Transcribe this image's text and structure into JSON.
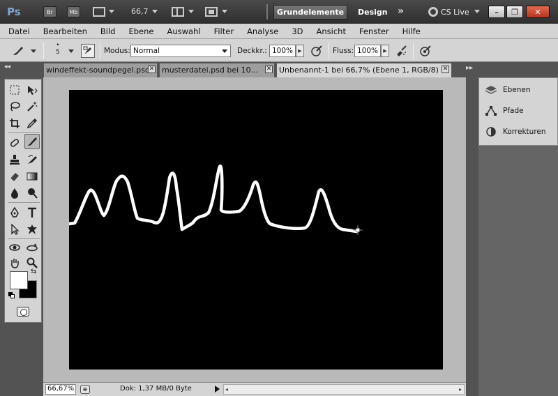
{
  "titlebar": {
    "logo": "Ps",
    "bridge_label": "Br",
    "minibridge_label": "Mb",
    "zoom": "66,7",
    "workspace_active": "Grundelemente",
    "workspace_design": "Design",
    "more_label": "»",
    "cslive_label": "CS Live",
    "minimize": "–",
    "restore": "❐",
    "close": "✕"
  },
  "menu": [
    "Datei",
    "Bearbeiten",
    "Bild",
    "Ebene",
    "Auswahl",
    "Filter",
    "Analyse",
    "3D",
    "Ansicht",
    "Fenster",
    "Hilfe"
  ],
  "options": {
    "brush_size": "5",
    "brush_dot": "•",
    "modus_label": "Modus:",
    "modus_value": "Normal",
    "deckkraft_label": "Deckkr.:",
    "deckkraft_value": "100%",
    "fluss_label": "Fluss:",
    "fluss_value": "100%"
  },
  "tabs": [
    {
      "label": "windeffekt-soundpegel.psd"
    },
    {
      "label": "musterdatei.psd bei 10..."
    },
    {
      "label": "Unbenannt-1 bei 66,7% (Ebene 1, RGB/8) *"
    }
  ],
  "tab_close": "✕",
  "panels": {
    "collapse_left": "◂◂",
    "collapse_right": "▸▸",
    "items": [
      {
        "label": "Ebenen",
        "icon": "layers-icon"
      },
      {
        "label": "Pfade",
        "icon": "paths-icon"
      },
      {
        "label": "Korrekturen",
        "icon": "adjustments-icon"
      }
    ]
  },
  "status": {
    "zoom": "66,67%",
    "doc_info": "Dok: 1,37 MB/0 Byte",
    "status_icon": "⊕",
    "scroll_left": "◂",
    "scroll_right": "▸"
  },
  "tools": {
    "swap": "⇆"
  },
  "colors": {
    "foreground": "#ffffff",
    "background": "#000000",
    "canvas": "#000000",
    "stroke": "#ffffff"
  }
}
